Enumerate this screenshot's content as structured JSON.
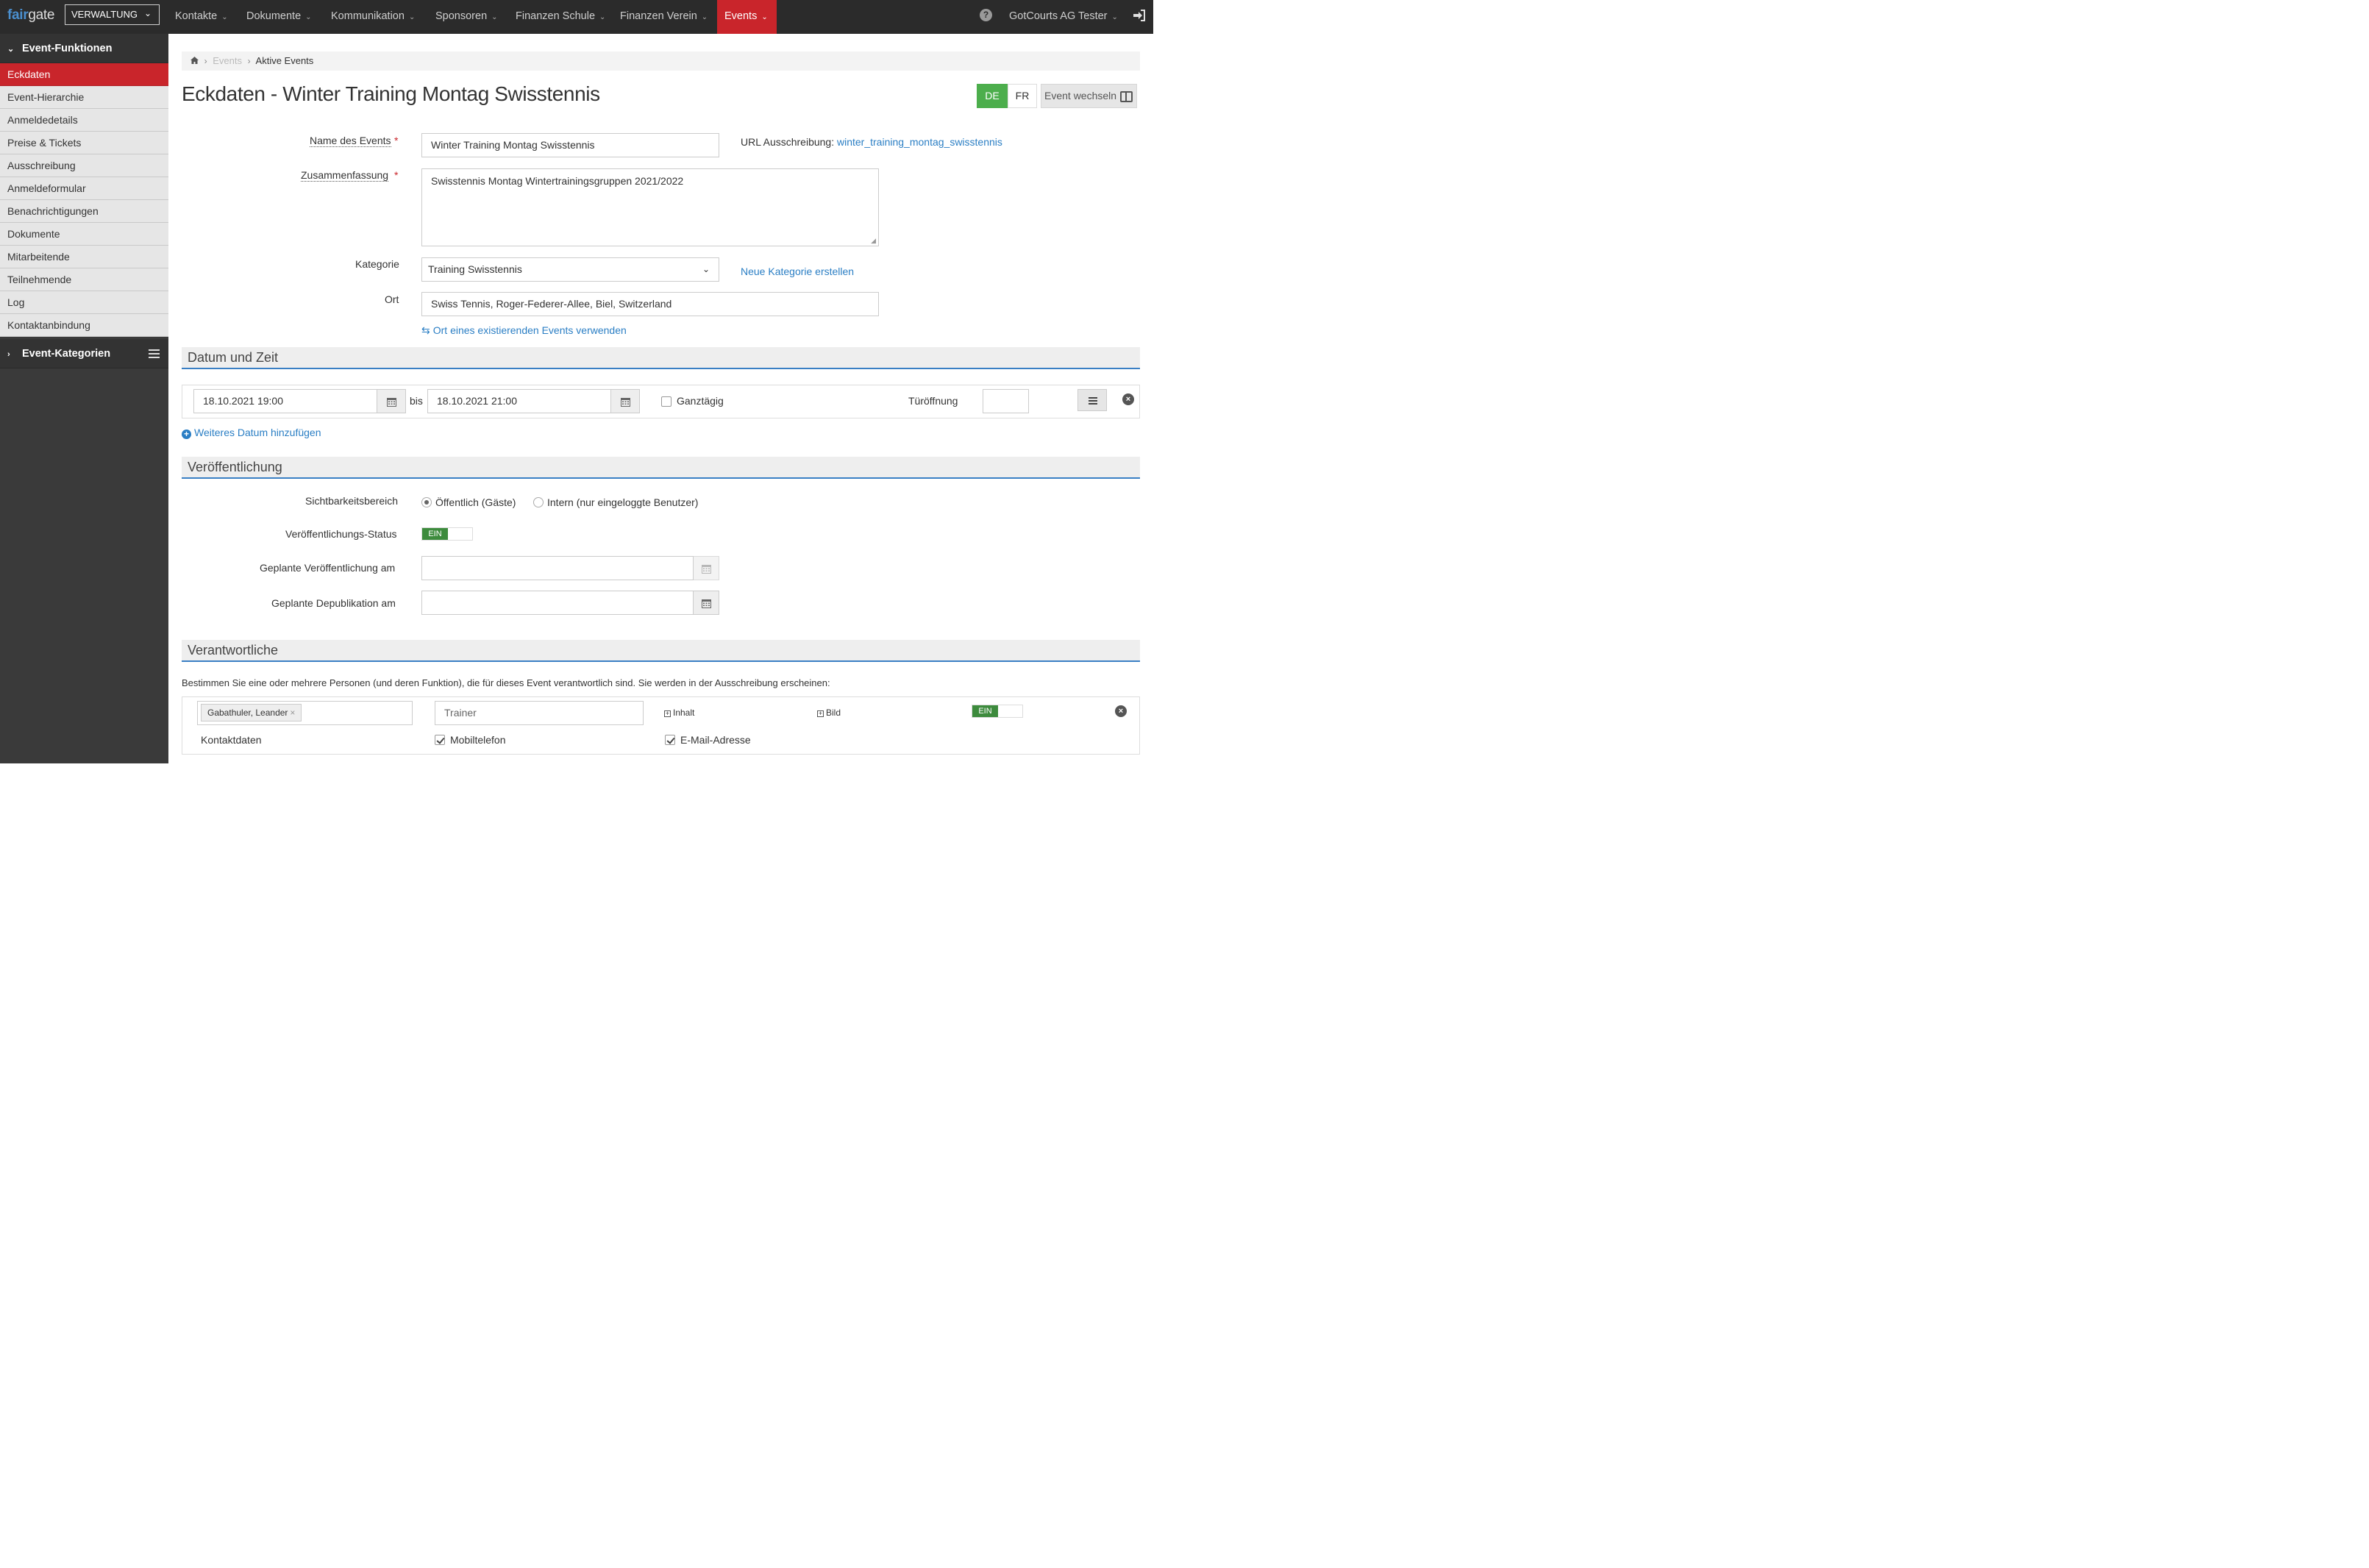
{
  "brand": {
    "part1": "fair",
    "part2": "gate"
  },
  "admin_select": {
    "value": "VERWALTUNG"
  },
  "nav": {
    "items": [
      {
        "label": "Kontakte"
      },
      {
        "label": "Dokumente"
      },
      {
        "label": "Kommunikation"
      },
      {
        "label": "Sponsoren"
      },
      {
        "label": "Finanzen Schule"
      },
      {
        "label": "Finanzen Verein"
      },
      {
        "label": "Events"
      }
    ],
    "active": "Events",
    "user": "GotCourts AG Tester",
    "accent": "#c9252b"
  },
  "sidebar": {
    "section1": "Event-Funktionen",
    "items": [
      {
        "label": "Eckdaten"
      },
      {
        "label": "Event-Hierarchie"
      },
      {
        "label": "Anmeldedetails"
      },
      {
        "label": "Preise & Tickets"
      },
      {
        "label": "Ausschreibung"
      },
      {
        "label": "Anmeldeformular"
      },
      {
        "label": "Benachrichtigungen"
      },
      {
        "label": "Dokumente"
      },
      {
        "label": "Mitarbeitende"
      },
      {
        "label": "Teilnehmende"
      },
      {
        "label": "Log"
      },
      {
        "label": "Kontaktanbindung"
      }
    ],
    "active": "Eckdaten",
    "section2": "Event-Kategorien"
  },
  "breadcrumb": {
    "events": "Events",
    "current": "Aktive Events"
  },
  "page": {
    "title": "Eckdaten - Winter Training Montag Swisstennis",
    "lang_de": "DE",
    "lang_fr": "FR",
    "event_switch": "Event wechseln"
  },
  "form": {
    "name_label": "Name des Events",
    "name_value": "Winter Training Montag Swisstennis",
    "url_label": "URL Ausschreibung:",
    "url_value": "winter_training_montag_swisstennis",
    "summary_label": "Zusammenfassung",
    "summary_value": "Swisstennis Montag Wintertrainingsgruppen 2021/2022",
    "category_label": "Kategorie",
    "category_value": "Training Swisstennis",
    "new_category": "Neue Kategorie erstellen",
    "location_label": "Ort",
    "location_value": "Swiss Tennis, Roger-Federer-Allee, Biel, Switzerland",
    "use_location": "Ort eines existierenden Events verwenden",
    "required_mark": "*"
  },
  "date_section": {
    "title": "Datum und Zeit",
    "start": "18.10.2021 19:00",
    "to": "bis",
    "end": "18.10.2021 21:00",
    "allday": "Ganztägig",
    "door_open": "Türöffnung",
    "door_value": "",
    "add_date": "Weiteres Datum hinzufügen"
  },
  "publish_section": {
    "title": "Veröffentlichung",
    "visibility_label": "Sichtbarkeitsbereich",
    "public": "Öffentlich (Gäste)",
    "internal": "Intern (nur eingeloggte Benutzer)",
    "status_label": "Veröffentlichungs-Status",
    "status_on": "EIN",
    "planned_pub_label": "Geplante Veröffentlichung am",
    "planned_depub_label": "Geplante Depublikation am"
  },
  "resp_section": {
    "title": "Verantwortliche",
    "description": "Bestimmen Sie eine oder mehrere Personen (und deren Funktion), die für dieses Event verantwortlich sind. Sie werden in der Ausschreibung erscheinen:",
    "person": "Gabathuler, Leander",
    "function": "Trainer",
    "content": "Inhalt",
    "image": "Bild",
    "toggle_on": "EIN",
    "contact_label": "Kontaktdaten",
    "mobile": "Mobiltelefon",
    "email": "E-Mail-Adresse"
  }
}
